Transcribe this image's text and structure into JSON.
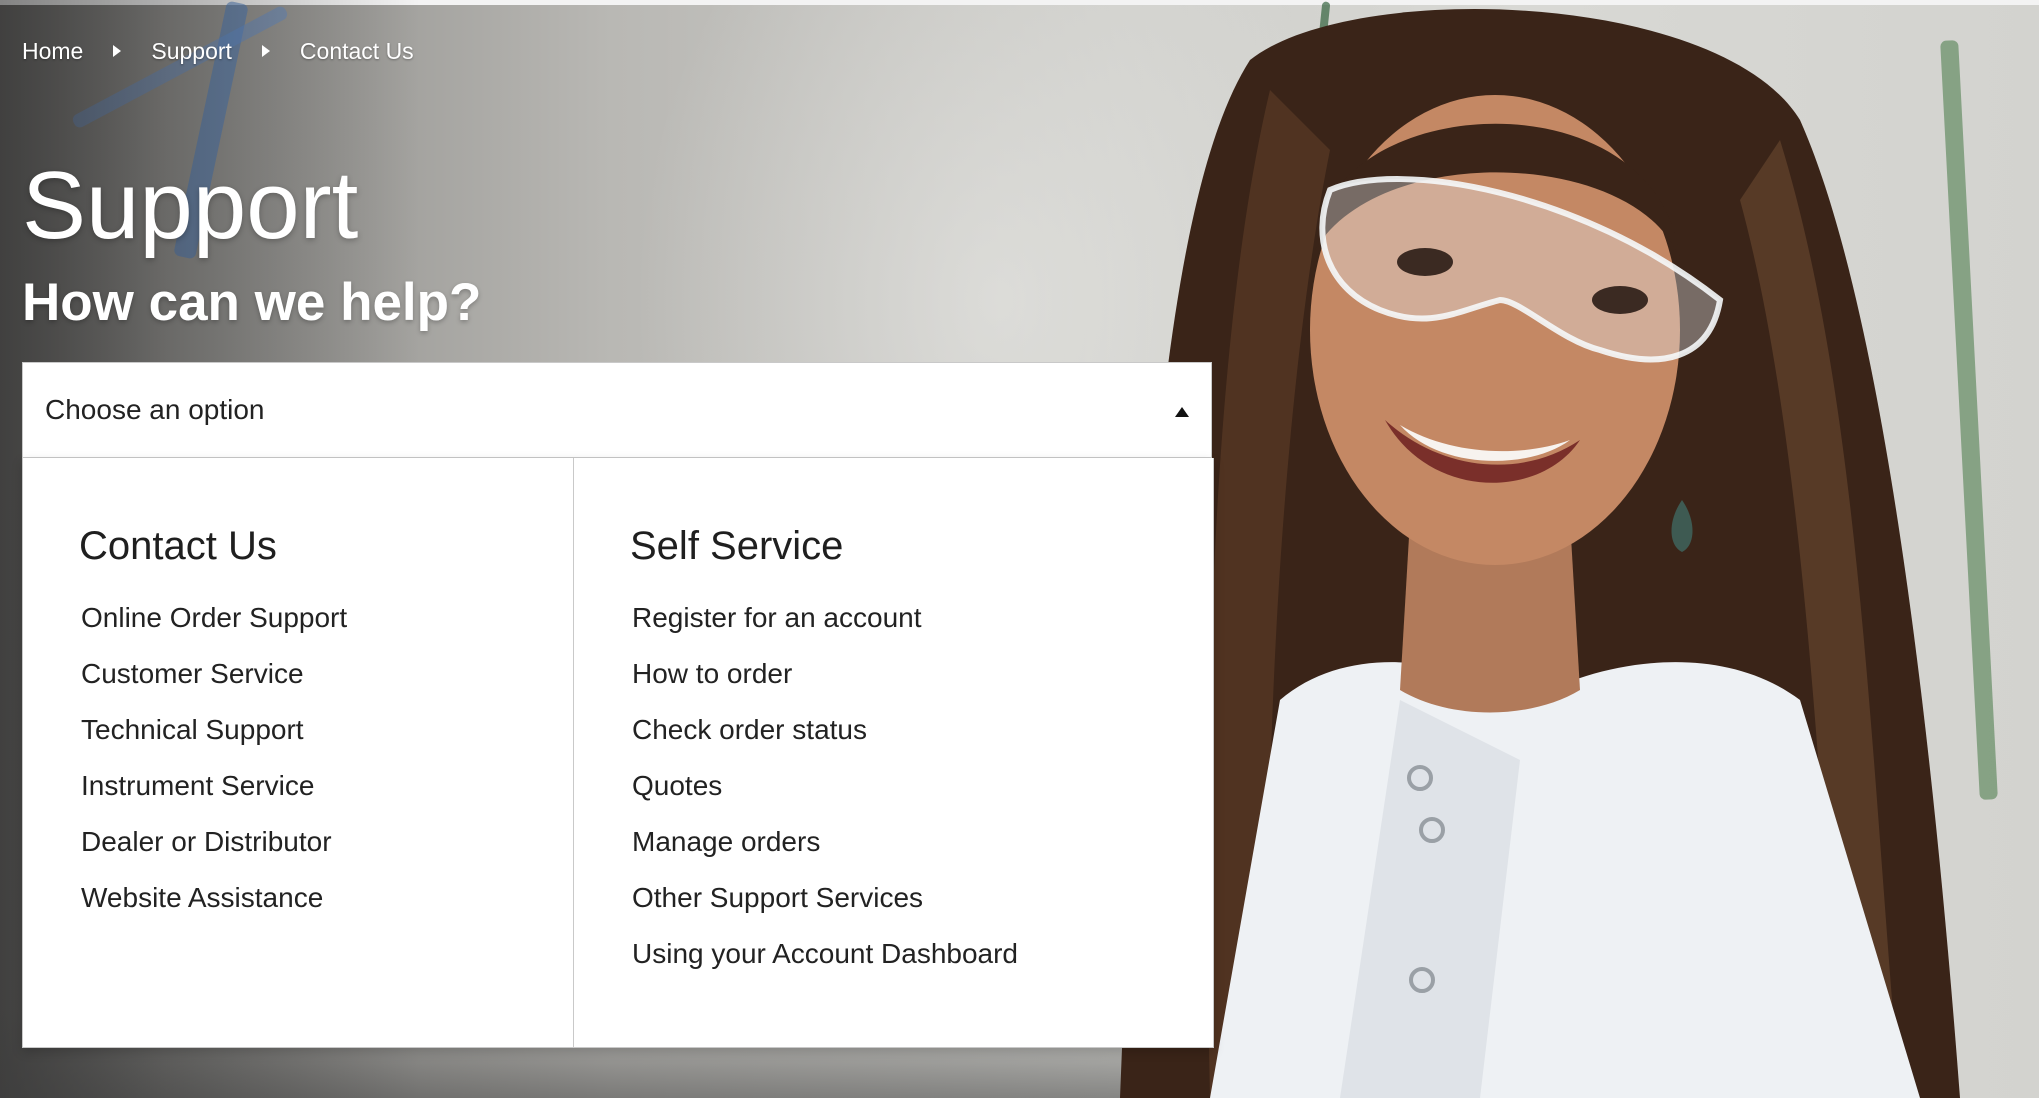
{
  "breadcrumb": {
    "items": [
      "Home",
      "Support",
      "Contact Us"
    ]
  },
  "header": {
    "title": "Support",
    "subtitle": "How can we help?"
  },
  "dropdown": {
    "selected": "Choose an option",
    "expanded": true,
    "columns": [
      {
        "heading": "Contact Us",
        "items": [
          "Online Order Support",
          "Customer Service",
          "Technical Support",
          "Instrument Service",
          "Dealer or Distributor",
          "Website Assistance"
        ]
      },
      {
        "heading": "Self Service",
        "items": [
          "Register for an account",
          "How to order",
          "Check order status",
          "Quotes",
          "Manage orders",
          "Other Support Services",
          "Using your Account Dashboard"
        ]
      }
    ]
  },
  "colors": {
    "text_on_hero": "#ffffff",
    "panel_background": "#ffffff",
    "panel_border": "#c9c9c9",
    "text_dark": "#222222"
  },
  "icons": {
    "breadcrumb_separator": "triangle-right-icon",
    "dropdown_toggle": "caret-up-icon"
  }
}
